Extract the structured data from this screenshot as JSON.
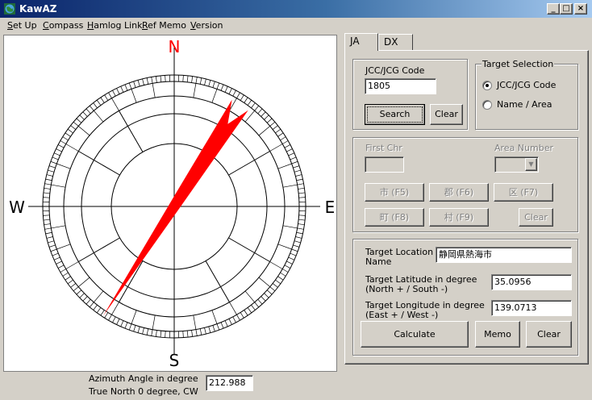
{
  "window": {
    "title": "KawAZ"
  },
  "caption_buttons": {
    "minimize": "_",
    "maximize": "□",
    "close": "×"
  },
  "menu": [
    {
      "hotkey": "S",
      "rest": "et Up"
    },
    {
      "hotkey": "C",
      "rest": "ompass"
    },
    {
      "hotkey": "H",
      "rest": "amlog Link"
    },
    {
      "hotkey": "R",
      "rest": "ef Memo"
    },
    {
      "hotkey": "V",
      "rest": "ersion"
    }
  ],
  "compass": {
    "north": "N",
    "south": "S",
    "east": "E",
    "west": "W",
    "needle_color": "#ff0000",
    "north_label_color": "#ff0000",
    "azimuth_deg": 212.988
  },
  "azimuth": {
    "label_line1": "Azimuth Angle in degree",
    "label_line2": "True North 0 degree, CW",
    "value": "212.988"
  },
  "tabs": {
    "ja": "JA",
    "dx": "DX",
    "active": "JA"
  },
  "code_group": {
    "title": "JCC/JCG Code",
    "value": "1805",
    "search_label": "Search",
    "clear_label": "Clear"
  },
  "target_selection": {
    "title": "Target Selection",
    "options": [
      "JCC/JCG Code",
      "Name / Area"
    ],
    "selected": "JCC/JCG Code"
  },
  "area_group": {
    "first_chr_label": "First Chr",
    "area_number_label": "Area Number",
    "buttons": [
      "市 (F5)",
      "郡 (F6)",
      "区 (F7)",
      "町 (F8)",
      "村 (F9)"
    ],
    "clear_label": "Clear"
  },
  "target": {
    "location_label_line1": "Target Location",
    "location_label_line2": "Name",
    "location_value": "静岡県熱海市",
    "lat_label_line1": "Target Latitude in degree",
    "lat_label_line2": "(North + / South -)",
    "lat_value": "35.0956",
    "lon_label_line1": "Target Longitude in degree",
    "lon_label_line2": "(East + / West -)",
    "lon_value": "139.0713",
    "calculate_label": "Calculate",
    "memo_label": "Memo",
    "clear_label": "Clear"
  }
}
